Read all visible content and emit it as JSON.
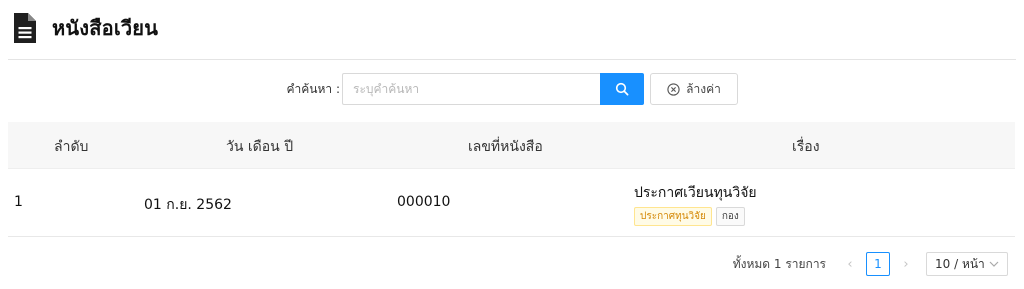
{
  "header": {
    "title": "หนังสือเวียน"
  },
  "search": {
    "label": "คำค้นหา :",
    "placeholder": "ระบุคำค้นหา",
    "value": "",
    "clear_label": "ล้างค่า"
  },
  "table": {
    "columns": [
      "ลำดับ",
      "วัน เดือน ปี",
      "เลขที่หนังสือ",
      "เรื่อง"
    ],
    "rows": [
      {
        "order": "1",
        "date": "01 ก.ย. 2562",
        "number": "000010",
        "subject": "ประกาศเวียนทุนวิจัย",
        "tags": [
          "ประกาศทุนวิจัย",
          "กอง"
        ]
      }
    ]
  },
  "pagination": {
    "total_text": "ทั้งหมด 1 รายการ",
    "current_page": "1",
    "page_size": "10 / หน้า",
    "prev_icon": "‹",
    "next_icon": "›"
  },
  "colors": {
    "primary": "#1890ff",
    "tag_gold": "#d48806"
  }
}
